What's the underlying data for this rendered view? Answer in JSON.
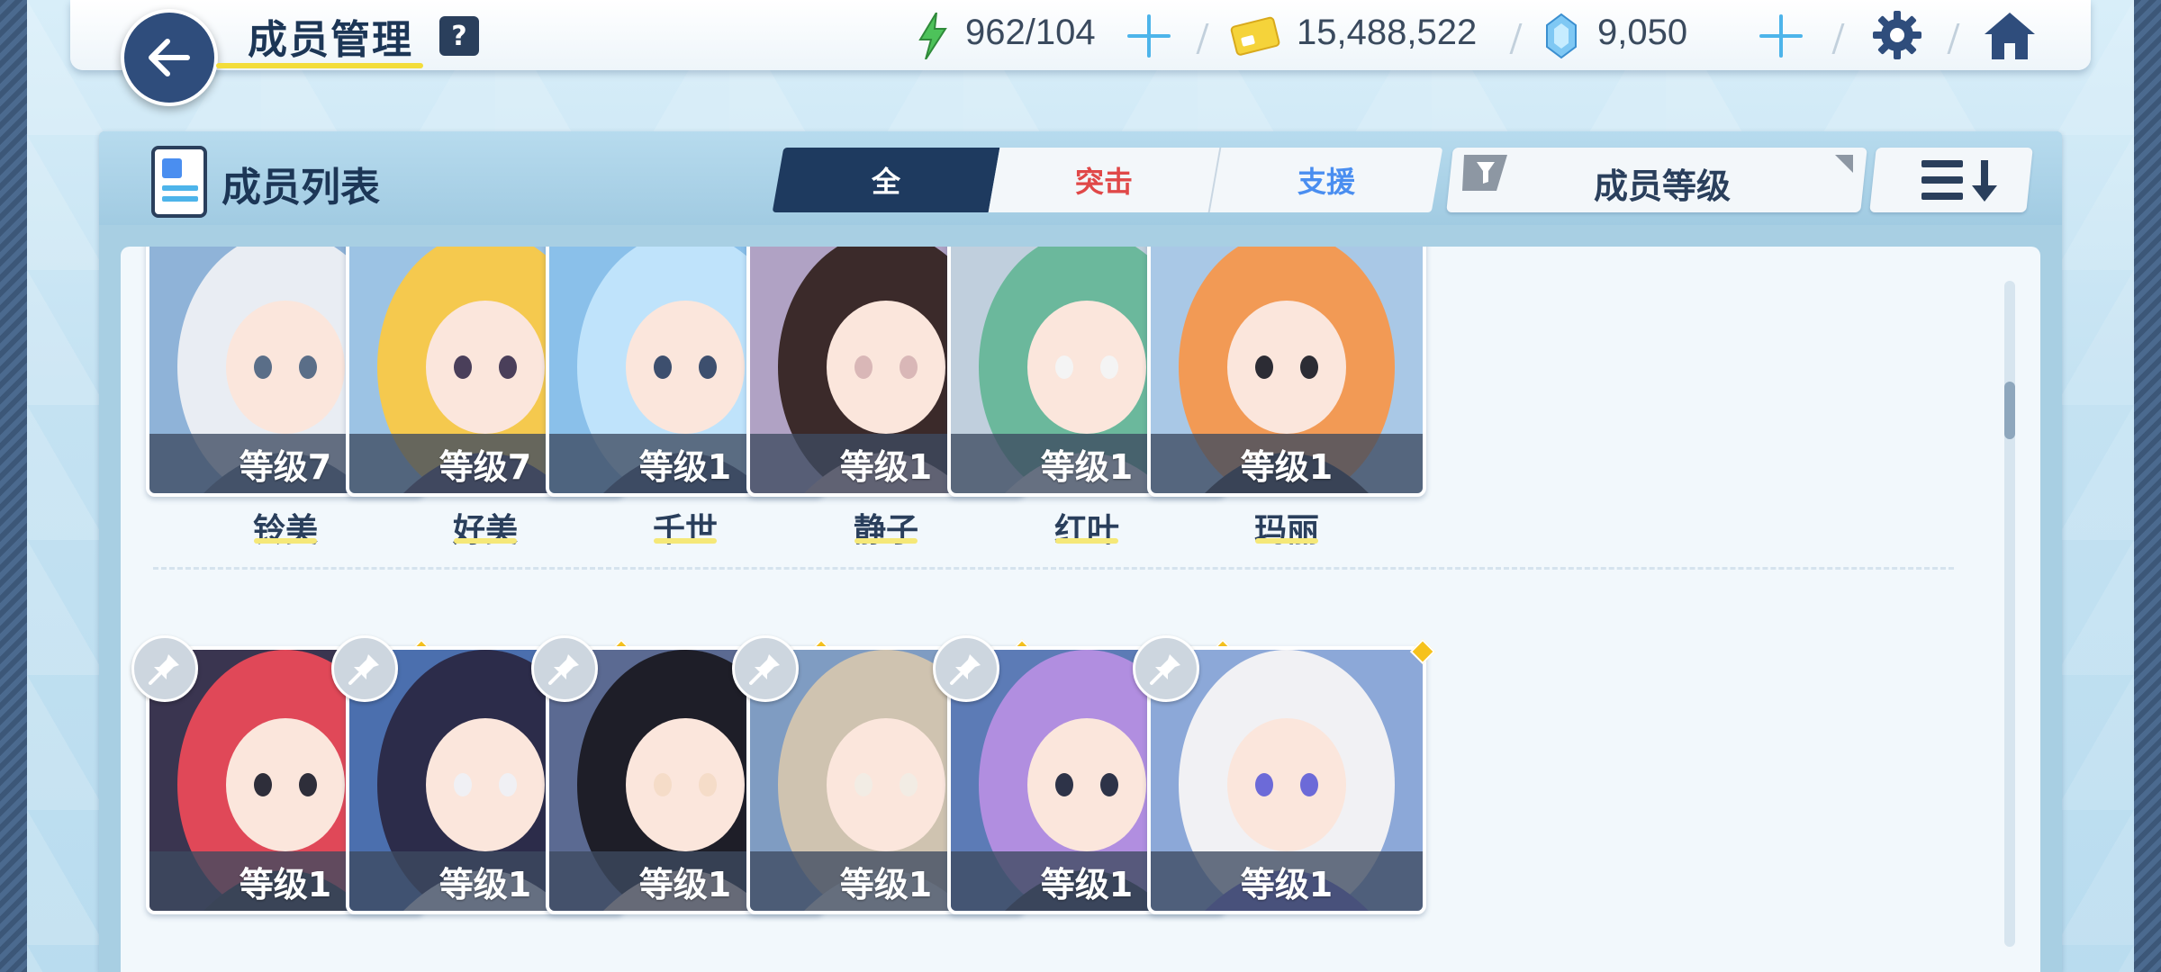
{
  "header": {
    "title": "成员管理",
    "help_label": "?",
    "ap": "962/104",
    "credits": "15,488,522",
    "gems": "9,050"
  },
  "panel": {
    "list_title": "成员列表",
    "tabs": [
      {
        "label": "全",
        "active": true
      },
      {
        "label": "突击",
        "active": false
      },
      {
        "label": "支援",
        "active": false
      }
    ],
    "sort_label": "成员等级"
  },
  "row1": [
    {
      "level": "等级7",
      "name": "铃美"
    },
    {
      "level": "等级7",
      "name": "好美"
    },
    {
      "level": "等级1",
      "name": "千世"
    },
    {
      "level": "等级1",
      "name": "静子"
    },
    {
      "level": "等级1",
      "name": "红叶"
    },
    {
      "level": "等级1",
      "name": "玛丽"
    }
  ],
  "row2": [
    {
      "level": "等级1"
    },
    {
      "level": "等级1"
    },
    {
      "level": "等级1"
    },
    {
      "level": "等级1"
    },
    {
      "level": "等级1"
    },
    {
      "level": "等级1"
    }
  ],
  "colors": {
    "dark_navy": "#1e3a5f",
    "assault": "#e04848",
    "support": "#4a8ef0",
    "accent_blue": "#4db4ea",
    "highlight_yellow": "#f3dd3a"
  }
}
